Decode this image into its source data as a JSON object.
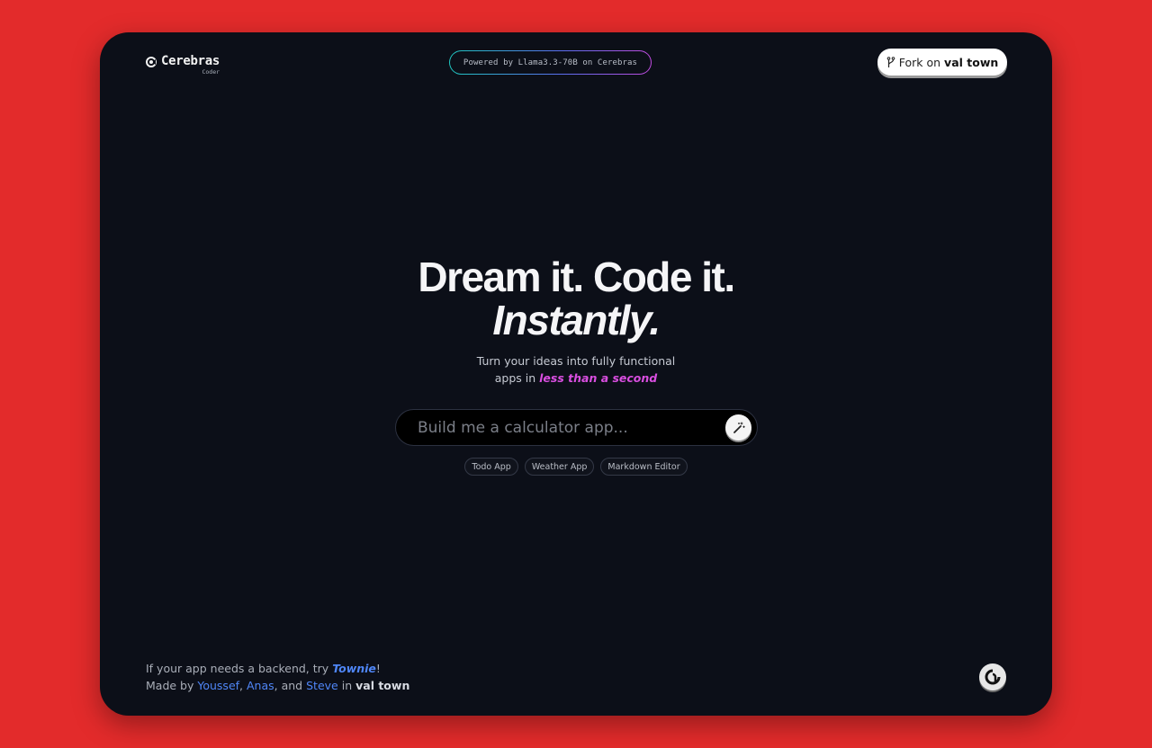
{
  "brand": {
    "name": "Cerebras",
    "sub": "Coder"
  },
  "powered_by": "Powered by Llama3.3-70B on Cerebras",
  "fork": {
    "prefix": "Fork on",
    "brand": "val town",
    "icon": "fork-icon"
  },
  "hero": {
    "line1": "Dream it. Code it.",
    "line2": "Instantly."
  },
  "subtitle": {
    "line1": "Turn your ideas into fully functional",
    "line2_prefix": "apps in",
    "line2_accent": "less than a second"
  },
  "prompt": {
    "placeholder": "Build me a calculator app...",
    "value": "",
    "button_icon": "magic-wand-icon"
  },
  "suggestions": [
    "Todo App",
    "Weather App",
    "Markdown Editor"
  ],
  "footer": {
    "line1_prefix": "If your app needs a backend, try",
    "line1_link": "Townie",
    "line1_suffix": "!",
    "made_by": "Made by",
    "author1": "Youssef",
    "author2": "Anas",
    "and": ", and",
    "author3": "Steve",
    "in": "in",
    "brand": "val town"
  },
  "colors": {
    "background": "#e32b2b",
    "panel": "#0c0f18",
    "accent": "#d94ee0",
    "link": "#4f86f7"
  }
}
